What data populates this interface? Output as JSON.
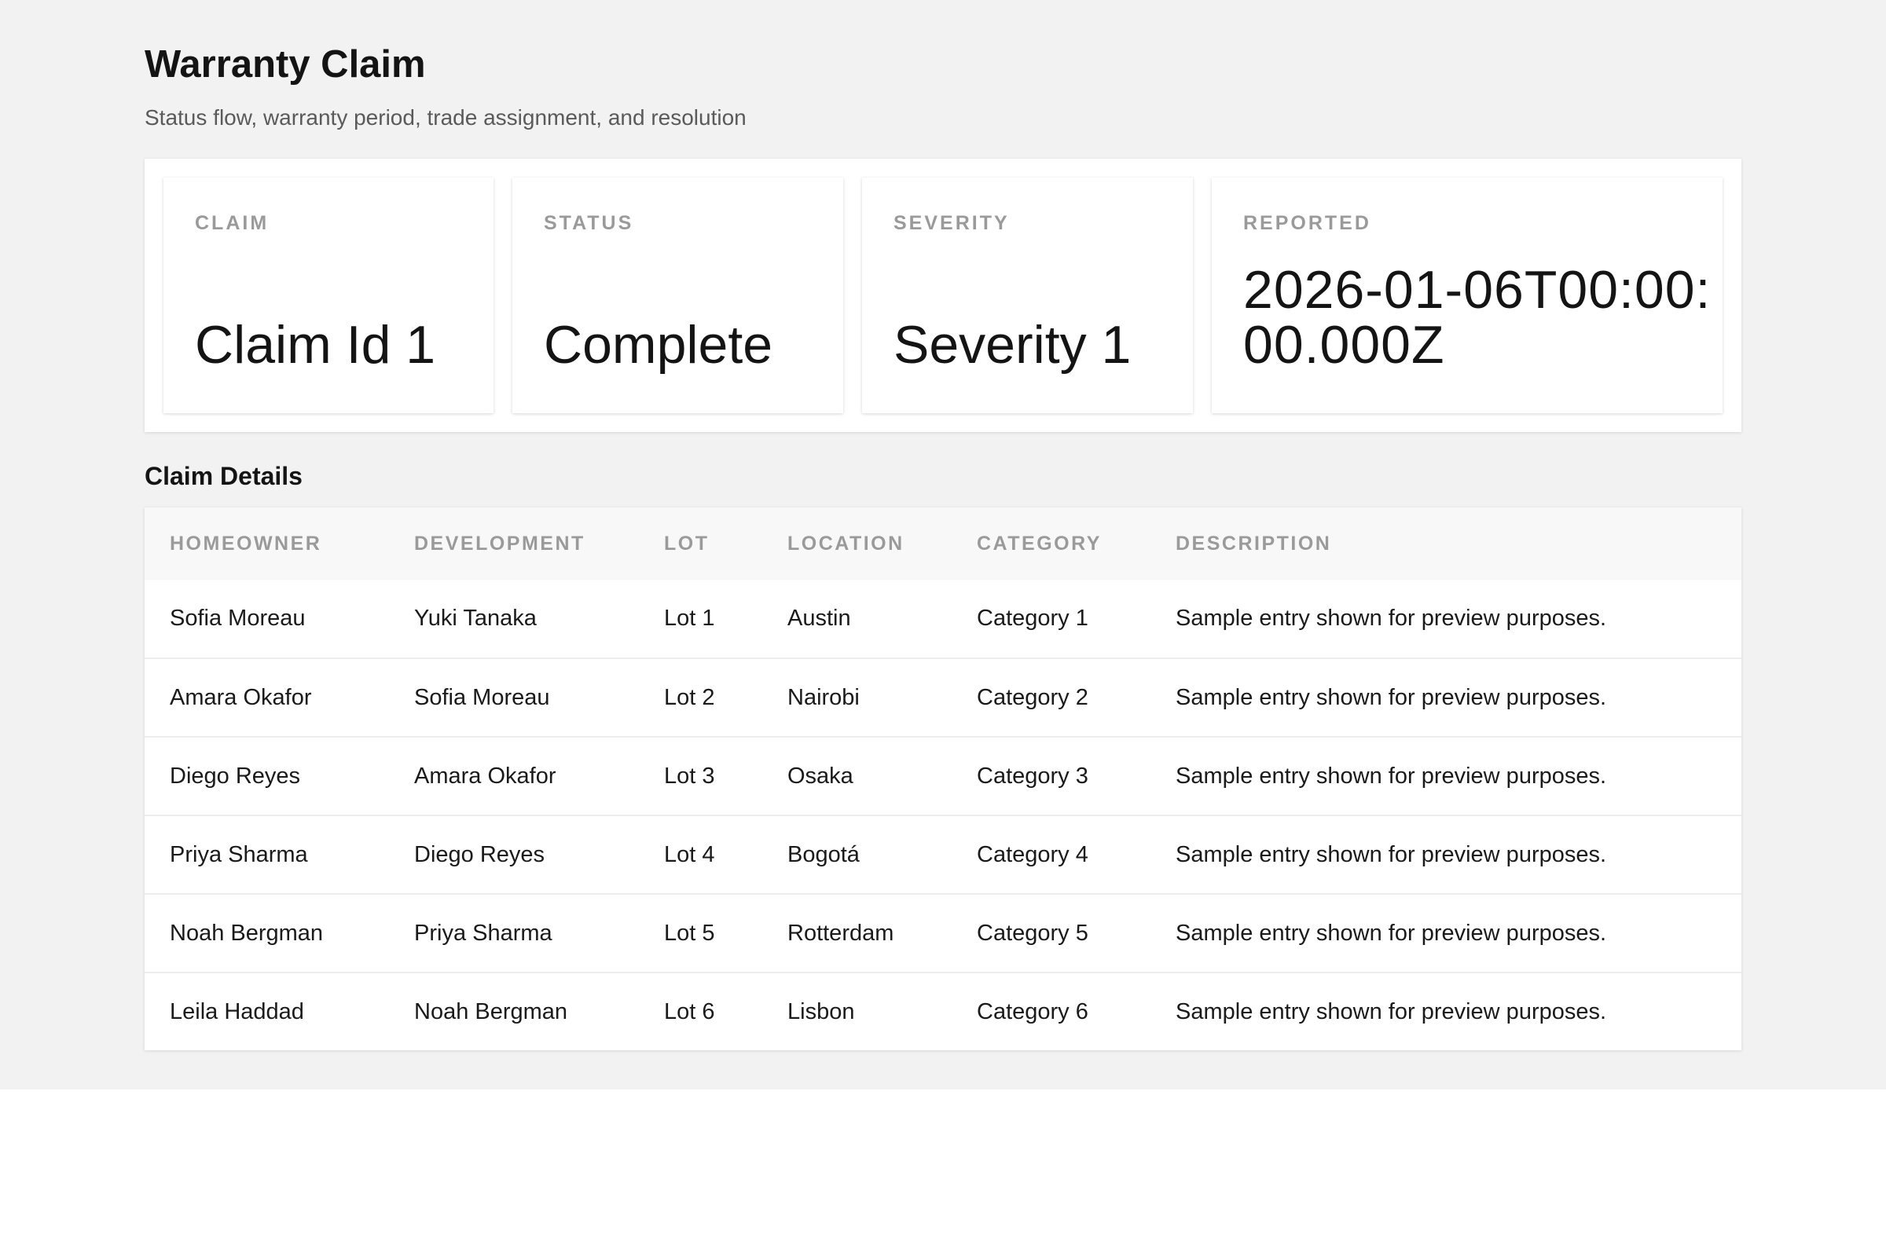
{
  "header": {
    "title": "Warranty Claim",
    "subtitle": "Status flow, warranty period, trade assignment, and resolution"
  },
  "summary": [
    {
      "label": "CLAIM",
      "value": "Claim Id 1"
    },
    {
      "label": "STATUS",
      "value": "Complete"
    },
    {
      "label": "SEVERITY",
      "value": "Severity 1"
    },
    {
      "label": "REPORTED",
      "value": "2026-01-06T00:00:00.000Z"
    }
  ],
  "details": {
    "title": "Claim Details",
    "columns": [
      "HOMEOWNER",
      "DEVELOPMENT",
      "LOT",
      "LOCATION",
      "CATEGORY",
      "DESCRIPTION"
    ],
    "rows": [
      {
        "homeowner": "Sofia Moreau",
        "development": "Yuki Tanaka",
        "lot": "Lot 1",
        "location": "Austin",
        "category": "Category 1",
        "description": "Sample entry shown for preview purposes."
      },
      {
        "homeowner": "Amara Okafor",
        "development": "Sofia Moreau",
        "lot": "Lot 2",
        "location": "Nairobi",
        "category": "Category 2",
        "description": "Sample entry shown for preview purposes."
      },
      {
        "homeowner": "Diego Reyes",
        "development": "Amara Okafor",
        "lot": "Lot 3",
        "location": "Osaka",
        "category": "Category 3",
        "description": "Sample entry shown for preview purposes."
      },
      {
        "homeowner": "Priya Sharma",
        "development": "Diego Reyes",
        "lot": "Lot 4",
        "location": "Bogotá",
        "category": "Category 4",
        "description": "Sample entry shown for preview purposes."
      },
      {
        "homeowner": "Noah Bergman",
        "development": "Priya Sharma",
        "lot": "Lot 5",
        "location": "Rotterdam",
        "category": "Category 5",
        "description": "Sample entry shown for preview purposes."
      },
      {
        "homeowner": "Leila Haddad",
        "development": "Noah Bergman",
        "lot": "Lot 6",
        "location": "Lisbon",
        "category": "Category 6",
        "description": "Sample entry shown for preview purposes."
      }
    ]
  }
}
